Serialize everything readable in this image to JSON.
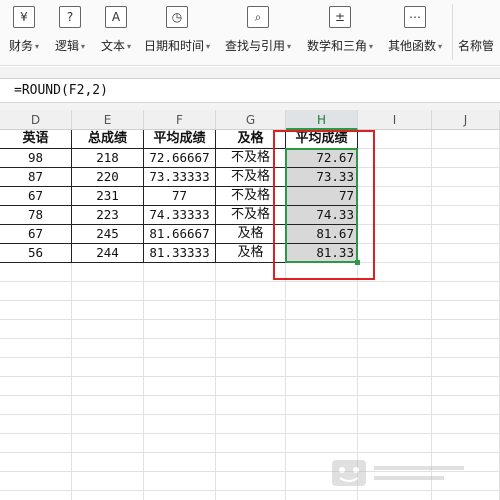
{
  "ribbon": {
    "items": [
      {
        "label": "财务",
        "icon": "¥",
        "icon_name": "finance-icon",
        "dropdown": true
      },
      {
        "label": "逻辑",
        "icon": "?",
        "icon_name": "logic-icon",
        "dropdown": true
      },
      {
        "label": "文本",
        "icon": "A",
        "icon_name": "text-icon",
        "dropdown": true
      },
      {
        "label": "日期和时间",
        "icon": "◷",
        "icon_name": "datetime-icon",
        "dropdown": true
      },
      {
        "label": "查找与引用",
        "icon": "⌕",
        "icon_name": "lookup-icon",
        "dropdown": true
      },
      {
        "label": "数学和三角",
        "icon": "±",
        "icon_name": "math-icon",
        "dropdown": true
      },
      {
        "label": "其他函数",
        "icon": "⋯",
        "icon_name": "other-functions-icon",
        "dropdown": true
      },
      {
        "label": "名称管",
        "icon_name": "name-manager-icon",
        "dropdown": false
      }
    ]
  },
  "formula_bar": {
    "formula": "=ROUND(F2,2)"
  },
  "columns": [
    {
      "label": "D",
      "selected": false
    },
    {
      "label": "E",
      "selected": false
    },
    {
      "label": "F",
      "selected": false
    },
    {
      "label": "G",
      "selected": false
    },
    {
      "label": "H",
      "selected": true
    },
    {
      "label": "I",
      "selected": false
    },
    {
      "label": "J",
      "selected": false
    }
  ],
  "table": {
    "headers": [
      "英语",
      "总成绩",
      "平均成绩",
      "及格",
      "平均成绩"
    ],
    "rows": [
      [
        "98",
        "218",
        "72.66667",
        "不及格",
        "72.67"
      ],
      [
        "87",
        "220",
        "73.33333",
        "不及格",
        "73.33"
      ],
      [
        "67",
        "231",
        "77",
        "不及格",
        "77"
      ],
      [
        "78",
        "223",
        "74.33333",
        "不及格",
        "74.33"
      ],
      [
        "67",
        "245",
        "81.66667",
        "及格",
        "81.67"
      ],
      [
        "56",
        "244",
        "81.33333",
        "及格",
        "81.33"
      ]
    ]
  },
  "colors": {
    "selection_green": "#2a9a4a",
    "annotation_red": "#e02020",
    "selected_fill": "#d8d8d8"
  }
}
